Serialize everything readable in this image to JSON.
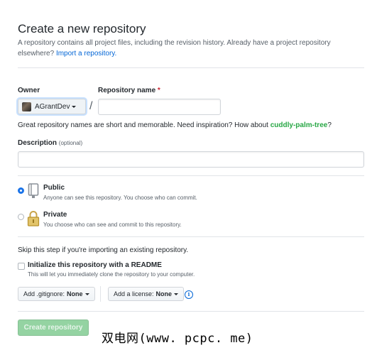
{
  "page": {
    "title": "Create a new repository",
    "subtitle_text": "A repository contains all project files, including the revision history. Already have a project repository elsewhere?",
    "import_link": "Import a repository."
  },
  "owner": {
    "label": "Owner",
    "value": "AGrantDev"
  },
  "repo_name": {
    "label": "Repository name",
    "required_marker": "*",
    "value": ""
  },
  "separator": "/",
  "name_hint": {
    "text": "Great repository names are short and memorable. Need inspiration? How about",
    "suggestion": "cuddly-palm-tree",
    "end": "?"
  },
  "description": {
    "label": "Description",
    "optional": "(optional)",
    "value": ""
  },
  "visibility": {
    "public": {
      "title": "Public",
      "desc": "Anyone can see this repository. You choose who can commit.",
      "selected": true
    },
    "private": {
      "title": "Private",
      "desc": "You choose who can see and commit to this repository.",
      "selected": false
    }
  },
  "skip_note": "Skip this step if you're importing an existing repository.",
  "readme": {
    "title": "Initialize this repository with a README",
    "desc": "This will let you immediately clone the repository to your computer.",
    "checked": false
  },
  "gitignore": {
    "label": "Add .gitignore:",
    "value": "None"
  },
  "license": {
    "label": "Add a license:",
    "value": "None"
  },
  "create_button": "Create repository",
  "watermark": "双电网(www. pcpc. me)",
  "colors": {
    "link": "#0366d6",
    "suggestion": "#28a745",
    "required": "#cb2431",
    "button_disabled": "#94d3a2",
    "radio_selected": "#1a73e8"
  }
}
